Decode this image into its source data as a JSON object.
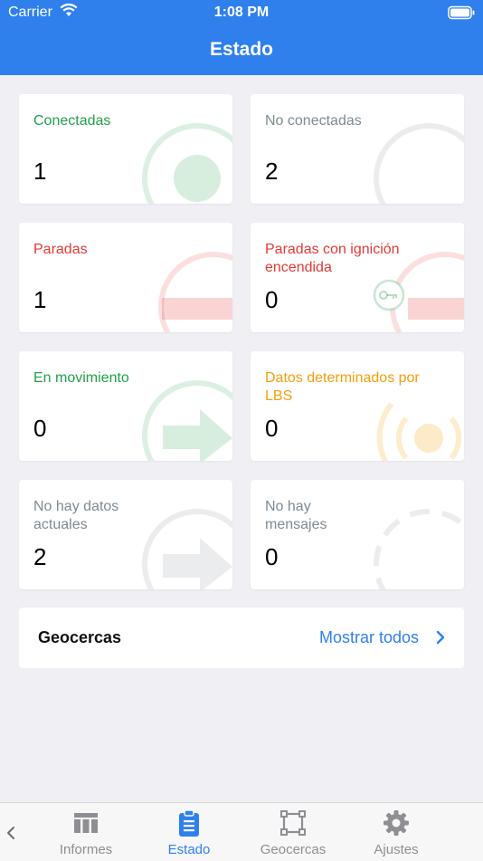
{
  "status_bar": {
    "carrier": "Carrier",
    "time": "1:08 PM"
  },
  "header": {
    "title": "Estado"
  },
  "cards": [
    {
      "label": "Conectadas",
      "count": "1",
      "color": "#21a04b"
    },
    {
      "label": "No conectadas",
      "count": "2",
      "color": "#7d8a93"
    },
    {
      "label": "Paradas",
      "count": "1",
      "color": "#e53935"
    },
    {
      "label": "Paradas con ignición encendida",
      "count": "0",
      "color": "#e53935"
    },
    {
      "label": "En movimiento",
      "count": "0",
      "color": "#21a04b"
    },
    {
      "label": "Datos determinados por LBS",
      "count": "0",
      "color": "#f59e0b"
    },
    {
      "label": "No hay datos actuales",
      "count": "2",
      "color": "#7d8a93"
    },
    {
      "label": "No hay mensajes",
      "count": "0",
      "color": "#7d8a93"
    }
  ],
  "geofences": {
    "title": "Geocercas",
    "show_all": "Mostrar todos"
  },
  "tabs": [
    {
      "label": "Informes",
      "icon": "reports-icon",
      "active": false
    },
    {
      "label": "Estado",
      "icon": "clipboard-icon",
      "active": true
    },
    {
      "label": "Geocercas",
      "icon": "geofence-icon",
      "active": false
    },
    {
      "label": "Ajustes",
      "icon": "gear-icon",
      "active": false
    }
  ],
  "colors": {
    "accent": "#2f80ed",
    "background": "#efeff4"
  }
}
